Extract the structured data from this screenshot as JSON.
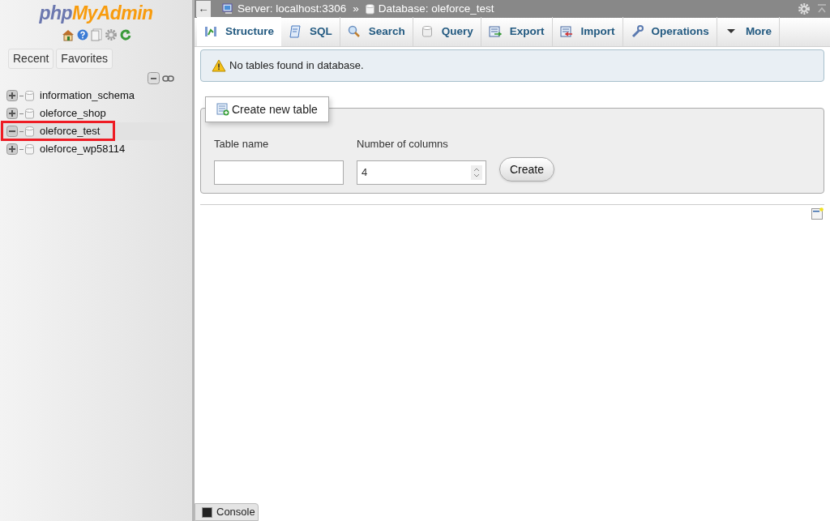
{
  "logo": {
    "part_1": "php",
    "part_2": "MyAdmin"
  },
  "sidebar": {
    "tabs": [
      "Recent",
      "Favorites"
    ],
    "databases": [
      {
        "name": "information_schema",
        "expanded": false,
        "selected": false
      },
      {
        "name": "oleforce_shop",
        "expanded": false,
        "selected": false
      },
      {
        "name": "oleforce_test",
        "expanded": true,
        "selected": true
      },
      {
        "name": "oleforce_wp58114",
        "expanded": false,
        "selected": false
      }
    ]
  },
  "breadcrumb": {
    "back": "←",
    "server": "Server: localhost:3306",
    "separator": "»",
    "database": "Database: oleforce_test"
  },
  "tabs": [
    {
      "label": "Structure",
      "selected": true
    },
    {
      "label": "SQL",
      "selected": false
    },
    {
      "label": "Search",
      "selected": false
    },
    {
      "label": "Query",
      "selected": false
    },
    {
      "label": "Export",
      "selected": false
    },
    {
      "label": "Import",
      "selected": false
    },
    {
      "label": "Operations",
      "selected": false
    },
    {
      "label": "More",
      "selected": false
    }
  ],
  "notice": "No tables found in database.",
  "create_table": {
    "legend": "Create new table",
    "table_name_label": "Table name",
    "columns_label": "Number of columns",
    "columns_value": "4",
    "button": "Create"
  },
  "console": "Console"
}
